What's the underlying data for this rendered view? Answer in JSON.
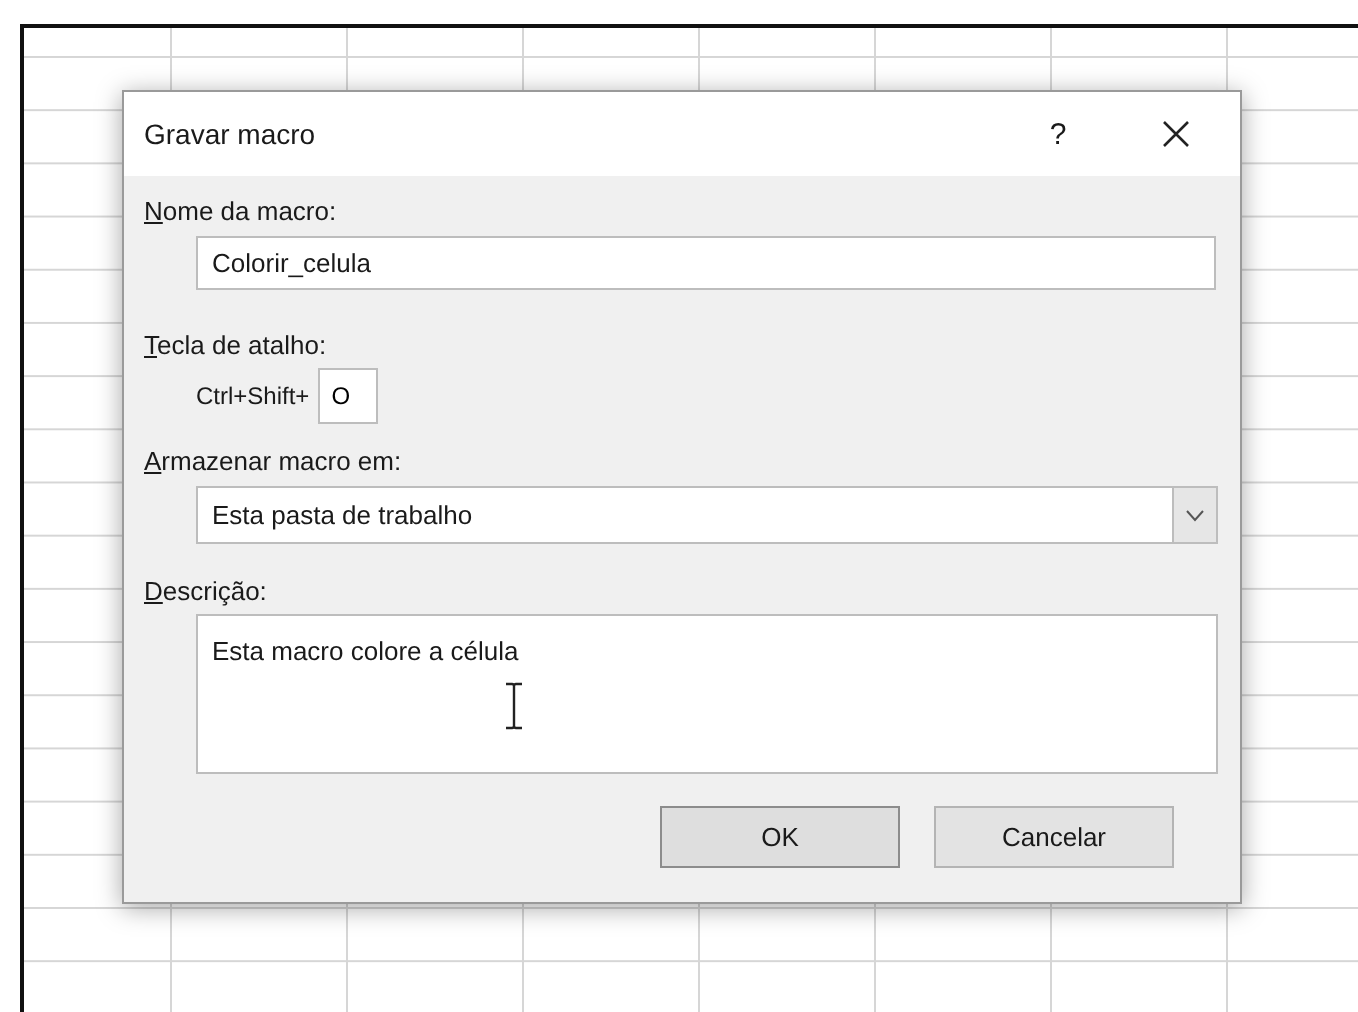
{
  "dialog": {
    "title": "Gravar macro",
    "help": "?",
    "name_label": "Nome da macro:",
    "name_value": "Colorir_celula",
    "shortcut_label": "Tecla de atalho:",
    "shortcut_prefix": "Ctrl+Shift+",
    "shortcut_key": "O",
    "store_label": "Armazenar macro em:",
    "store_value": "Esta pasta de trabalho",
    "description_label": "Descrição:",
    "description_value": "Esta macro colore a célula",
    "buttons": [
      {
        "label": "OK",
        "kind": "ok"
      },
      {
        "label": "Cancelar",
        "kind": "cancel"
      }
    ]
  }
}
